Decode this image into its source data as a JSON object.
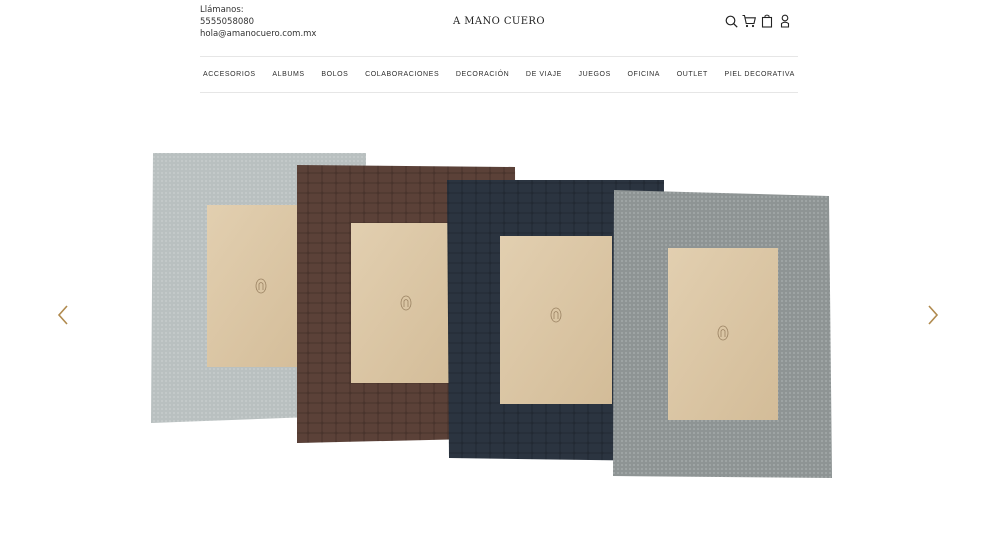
{
  "header": {
    "contact_label": "Llámanos:",
    "phone": "5555058080",
    "email": "hola@amanocuero.com.mx",
    "logo": "A MANO CUERO",
    "icons": [
      "search-icon",
      "cart-icon",
      "bag-icon",
      "user-icon"
    ]
  },
  "nav": {
    "items": [
      {
        "label": "ACCESORIOS"
      },
      {
        "label": "ALBUMS"
      },
      {
        "label": "BOLOS"
      },
      {
        "label": "COLABORACIONES"
      },
      {
        "label": "DECORACIÓN"
      },
      {
        "label": "DE VIAJE"
      },
      {
        "label": "JUEGOS"
      },
      {
        "label": "OFICINA"
      },
      {
        "label": "OUTLET"
      },
      {
        "label": "PIEL DECORATIVA"
      }
    ]
  },
  "hero": {
    "prev_icon": "chevron-left-icon",
    "next_icon": "chevron-right-icon",
    "frames": [
      {
        "name": "frame-light-gray-shagreen",
        "color": "#b9bfbf"
      },
      {
        "name": "frame-brown-croc",
        "color": "#5a4038"
      },
      {
        "name": "frame-navy-croc",
        "color": "#2c3440"
      },
      {
        "name": "frame-gray-shagreen",
        "color": "#8f9494"
      }
    ],
    "mat_color": "#d9c4a4"
  }
}
